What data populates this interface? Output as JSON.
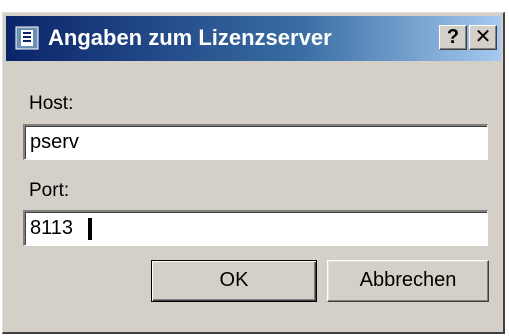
{
  "window": {
    "title": "Angaben zum Lizenzserver",
    "help_label": "?",
    "close_label": "✕"
  },
  "form": {
    "host_label": "Host:",
    "host_value": "pserv",
    "port_label": "Port:",
    "port_value": "8113"
  },
  "buttons": {
    "ok_label": "OK",
    "cancel_label": "Abbrechen"
  },
  "icons": {
    "app": "license-server-icon",
    "help": "help-icon",
    "close": "close-icon"
  },
  "colors": {
    "titlebar_start": "#0a246a",
    "titlebar_end": "#a6caf0",
    "window_bg": "#d4d0c8"
  }
}
